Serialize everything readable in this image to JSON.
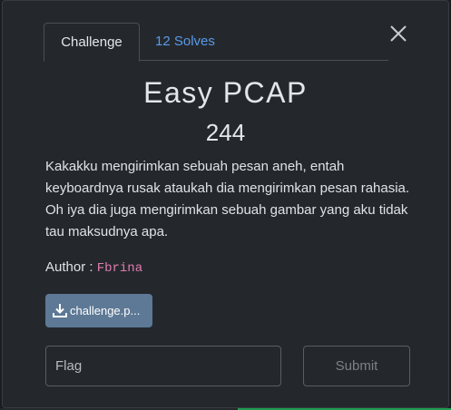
{
  "tabs": {
    "challenge_label": "Challenge",
    "solves_label": "12 Solves"
  },
  "challenge": {
    "title": "Easy PCAP",
    "points": "244",
    "description": "Kakakku mengirimkan sebuah pesan aneh, entah keyboardnya rusak ataukah dia mengirimkan pesan rahasia. Oh iya dia juga mengirimkan sebuah gambar yang aku tidak tau maksudnya apa.",
    "author_label": "Author : ",
    "author_name": "Fbrina",
    "file_label": "challenge.p..."
  },
  "form": {
    "flag_placeholder": "Flag",
    "flag_value": "",
    "submit_label": "Submit"
  },
  "icons": {
    "close": "close-icon",
    "download": "download-icon"
  },
  "colors": {
    "accent_link": "#5a9ae8",
    "author": "#e07cb0",
    "download_button": "#5d7996"
  }
}
